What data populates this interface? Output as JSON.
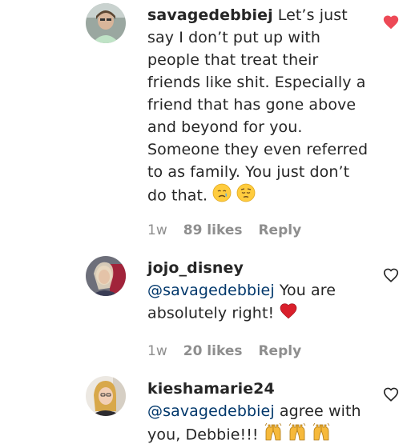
{
  "comments": [
    {
      "username": "savagedebbiej",
      "text": "Let’s just say I don’t put up with people that treat their friends like shit. Especially a friend that has gone above and beyond for you. Someone they even referred to as family. You just don’t do that.",
      "emojis": [
        "sad-relieved-face-emoji",
        "pensive-face-emoji"
      ],
      "time": "1w",
      "likes": "89 likes",
      "reply": "Reply",
      "liked": true,
      "heart_color": "#ed4956"
    },
    {
      "username": "jojo_disney",
      "mention": "@savagedebbiej",
      "text": "You are absolutely right!",
      "emojis": [
        "red-heart-emoji"
      ],
      "time": "1w",
      "likes": "20 likes",
      "reply": "Reply",
      "liked": false
    },
    {
      "username": "kieshamarie24",
      "mention": "@savagedebbiej",
      "text": "agree with you, Debbie!!!",
      "emojis": [
        "raising-hands-emoji",
        "raising-hands-emoji",
        "raising-hands-emoji"
      ],
      "liked": false
    }
  ],
  "colors": {
    "text": "#262626",
    "secondary": "#8e8e8e",
    "mention": "#00376b",
    "liked_heart": "#ed4956"
  }
}
